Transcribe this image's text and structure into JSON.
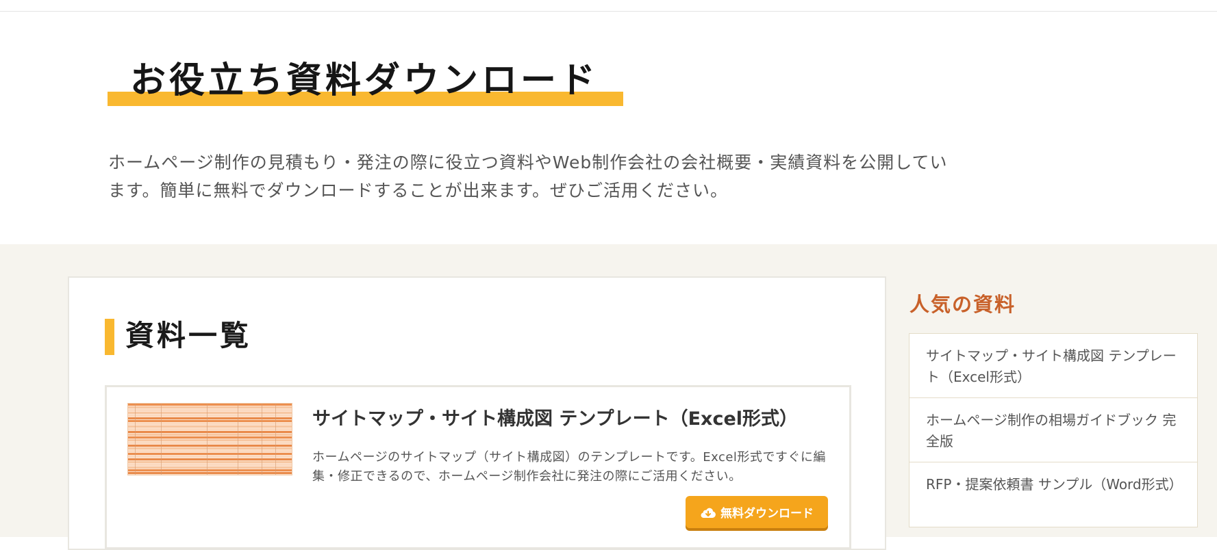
{
  "hero": {
    "title": "お役立ち資料ダウンロード",
    "description": "ホームページ制作の見積もり・発注の際に役立つ資料やWeb制作会社の会社概要・実績資料を公開しています。簡単に無料でダウンロードすることが出来ます。ぜひご活用ください。"
  },
  "main": {
    "section_title": "資料一覧",
    "documents": [
      {
        "title": "サイトマップ・サイト構成図 テンプレート（Excel形式）",
        "description": "ホームページのサイトマップ（サイト構成図）のテンプレートです。Excel形式ですぐに編集・修正できるので、ホームページ制作会社に発注の際にご活用ください。",
        "download_label": "無料ダウンロード",
        "thumbnail_icon": "spreadsheet-thumbnail"
      }
    ]
  },
  "sidebar": {
    "title": "人気の資料",
    "items": [
      {
        "label": "サイトマップ・サイト構成図 テンプレート（Excel形式）"
      },
      {
        "label": "ホームページ制作の相場ガイドブック 完全版"
      },
      {
        "label": "RFP・提案依頼書 サンプル（Word形式）"
      }
    ]
  },
  "colors": {
    "accent_yellow": "#f9b830",
    "button_orange": "#f5a51c",
    "sidebar_title": "#c8612a",
    "background_beige": "#f6f4ee"
  }
}
